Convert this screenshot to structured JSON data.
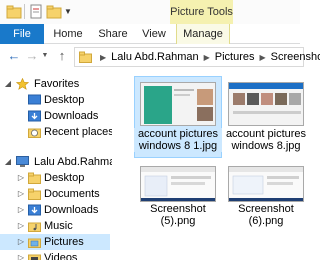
{
  "ribbon": {
    "tools_label": "Picture Tools",
    "tabs": [
      "File",
      "Home",
      "Share",
      "View",
      "Manage"
    ]
  },
  "address": {
    "crumbs": [
      "Lalu Abd.Rahman",
      "Pictures",
      "Screenshots"
    ]
  },
  "nav_pane": {
    "favorites_label": "Favorites",
    "favorites": [
      "Desktop",
      "Downloads",
      "Recent places"
    ],
    "user_label": "Lalu Abd.Rahman",
    "user_items": [
      "Desktop",
      "Documents",
      "Downloads",
      "Music",
      "Pictures",
      "Videos"
    ]
  },
  "files": [
    {
      "line1": "account pictures",
      "line2": "windows 8 1.jpg"
    },
    {
      "line1": "account pictures",
      "line2": "windows 8.jpg"
    },
    {
      "line1": "Screenshot",
      "line2": "(5).png"
    },
    {
      "line1": "Screenshot",
      "line2": "(6).png"
    }
  ],
  "colors": {
    "accent": "#1979ca",
    "selection": "#cce8ff",
    "tools_tab": "#f5f1b0"
  },
  "icons": {
    "quick_access_folder": "folder-icon",
    "back": "back-arrow-icon",
    "forward": "forward-arrow-icon",
    "up": "up-arrow-icon",
    "favorites": "star-icon",
    "computer": "computer-icon"
  }
}
